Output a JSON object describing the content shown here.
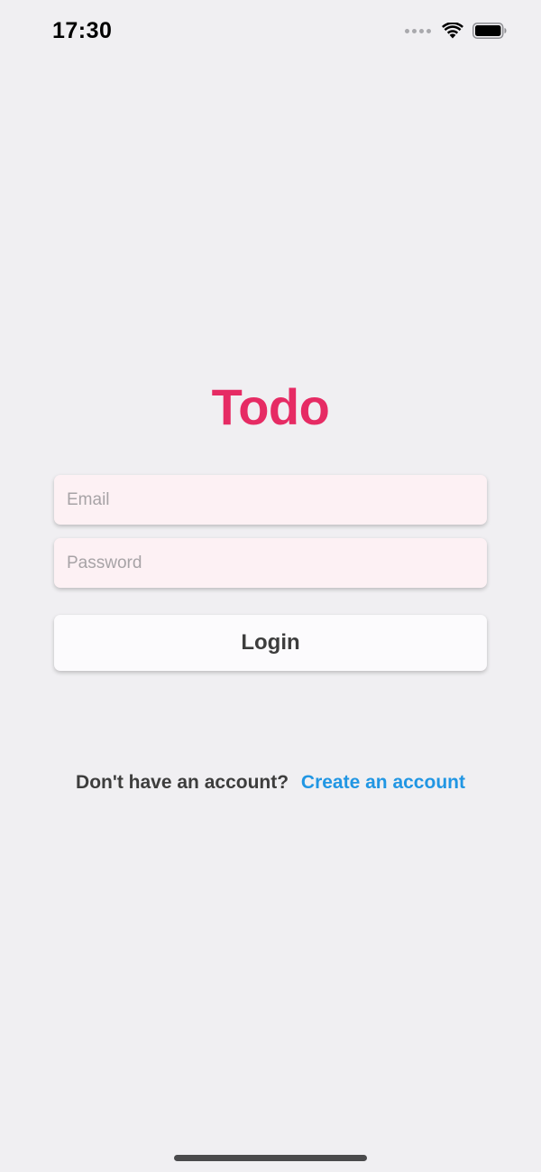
{
  "status_bar": {
    "time": "17:30",
    "icons": [
      "signal-dots-icon",
      "wifi-icon",
      "battery-icon"
    ]
  },
  "app": {
    "title": "Todo"
  },
  "login_form": {
    "email_placeholder": "Email",
    "email_value": "",
    "password_placeholder": "Password",
    "password_value": "",
    "login_label": "Login"
  },
  "signup": {
    "prompt": "Don't have an account?",
    "link_label": "Create an account"
  },
  "colors": {
    "background": "#f0eff2",
    "title": "#e62b64",
    "link": "#2196e3",
    "field_background": "#fdf1f4",
    "button_text": "#3d3d3d"
  }
}
